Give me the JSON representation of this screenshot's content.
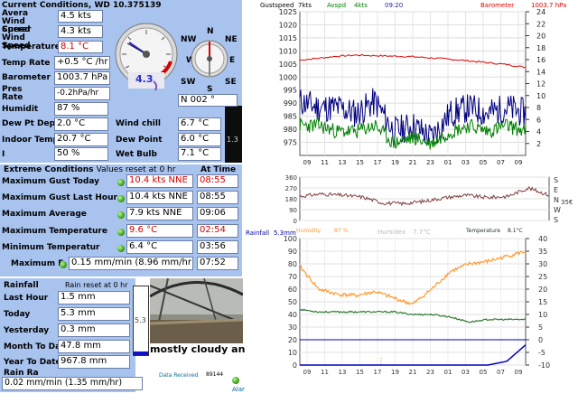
{
  "current": {
    "title": "Current Conditions, WD 10.375139",
    "avg_wind_label": "Avera Wind Speed",
    "avg_wind_value": "4.5 kts",
    "cur_wind_label": "Currer Wind Speed",
    "cur_wind_value": "4.3 kts",
    "temp_label": "Temperature",
    "temp_value": "8.1 °C",
    "temp_rate_label": "Temp Rate",
    "temp_rate_value": "+0.5 °C /hr",
    "baro_label": "Barometer",
    "baro_value": "1003.7 hPa",
    "pres_rate_label": "Pres Rate",
    "pres_rate_value": "-0.2hPa/hr",
    "humid_label": "Humidit",
    "humid_value": "87 %",
    "dewpt_label": "Dew Pt Depr",
    "dewpt_value": "2.0 °C",
    "indoor_label": "Indoor Temp",
    "indoor_value": "20.7 °C",
    "i_label": "I",
    "i_value": "50 %",
    "windchill_label": "Wind chill",
    "windchill_value": "6.7 °C",
    "dewpoint_label": "Dew Point",
    "dewpoint_value": "6.0 °C",
    "wetbulb_label": "Wet Bulb",
    "wetbulb_value": "7.1 °C",
    "side_value": "1.3",
    "gauge_value": "4.3",
    "compass": {
      "n": "N",
      "ne": "NE",
      "e": "E",
      "se": "SE",
      "s": "S",
      "sw": "SW",
      "w": "W",
      "nw": "NW"
    },
    "direction_value": "N  002 °"
  },
  "extreme": {
    "title": "Extreme Conditions",
    "reset_note": "Values reset at 0 hr",
    "at_time": "At Time",
    "rows": [
      {
        "label": "Maximum Gust Today",
        "value": "10.4 kts NNE",
        "time": "08:55"
      },
      {
        "label": "Maximum Gust Last Hour",
        "value": "10.4 kts NNE",
        "time": "08:55"
      },
      {
        "label": "Maximum Average",
        "value": "7.9 kts NNE",
        "time": "09:06"
      },
      {
        "label": "Maximum Temperature",
        "value": "9.6 °C",
        "time": "02:54"
      },
      {
        "label": "Minimum Temperatur",
        "value": "6.4 °C",
        "time": "03:56"
      },
      {
        "label": "Maximum F",
        "value": "0.15 mm/min (8.96 mm/hr)",
        "time": "07:52"
      }
    ]
  },
  "rain": {
    "title": "Rainfall",
    "reset_note": "Rain reset at 0 hr",
    "rows": [
      {
        "label": "Last Hour",
        "value": "1.5 mm"
      },
      {
        "label": "Today",
        "value": "5.3 mm"
      },
      {
        "label": "Yesterday",
        "value": "0.3 mm"
      },
      {
        "label": "Month To Dat",
        "value": "47.8 mm"
      },
      {
        "label": "Year To Date",
        "value": "967.8 mm"
      }
    ],
    "rate_label": "Rain Ra",
    "rate_value": "0.02 mm/min (1.35 mm/hr)",
    "bar_value": "5.3",
    "bar_fill": 0.05
  },
  "status": {
    "forecast": "mostly cloudy an",
    "time": "09:20:00",
    "data_received_label": "Data Received",
    "data_received_value": "89144",
    "alarm": "Alar"
  },
  "colors": {
    "panel": "#a9c3ef",
    "gust": "#000080",
    "avspd": "#008000",
    "barometer": "#e00000",
    "humidity": "#ff9a2e",
    "temperature": "#2f7a2f",
    "rain": "#0000c0",
    "direction": "#804040"
  },
  "chart_data": [
    {
      "type": "line",
      "legend": {
        "gust_label": "Gustspeed",
        "gust_value": "7kts",
        "avspd_label": "Avspd",
        "avspd_value": "4kts",
        "time": "09:20",
        "baro_label": "Barometer",
        "baro_value": "1003.7 hPa"
      },
      "x": [
        "09",
        "11",
        "13",
        "15",
        "17",
        "19",
        "21",
        "23",
        "01",
        "03",
        "05",
        "07",
        "09"
      ],
      "left_axis": {
        "ylim": [
          970,
          1025
        ],
        "ticks": [
          975,
          980,
          985,
          990,
          995,
          1000,
          1005,
          1010,
          1015,
          1020,
          1025
        ]
      },
      "right_axis": {
        "ylim": [
          0,
          24
        ],
        "ticks": [
          2,
          4,
          6,
          8,
          10,
          12,
          14,
          16,
          18,
          20,
          22,
          24
        ]
      },
      "series": [
        {
          "name": "Barometer",
          "values": [
            1006.5,
            1007.2,
            1008.0,
            1008.4,
            1008.2,
            1008.0,
            1007.8,
            1007.3,
            1006.8,
            1006.2,
            1005.5,
            1004.8,
            1003.7
          ]
        },
        {
          "name": "Gustspeed",
          "values": [
            9,
            8,
            8,
            7,
            9,
            4,
            5,
            3,
            7,
            8,
            7,
            8,
            7
          ]
        },
        {
          "name": "Avspd",
          "values": [
            5,
            5,
            4,
            4,
            5,
            2,
            3,
            2,
            4,
            5,
            4,
            5,
            4
          ]
        }
      ]
    },
    {
      "type": "line",
      "left_axis": {
        "ylim": [
          0,
          360
        ],
        "ticks": [
          0,
          90,
          180,
          270,
          360
        ]
      },
      "right_labels": [
        "S",
        "E",
        "N",
        "W",
        "S"
      ],
      "right_value": "35€",
      "series": [
        {
          "name": "Direction",
          "values": [
            200,
            220,
            210,
            195,
            145,
            140,
            160,
            190,
            210,
            190,
            200,
            270,
            210
          ]
        }
      ]
    },
    {
      "type": "line",
      "legend": {
        "rain_label": "Rainfall",
        "rain_value": "5.3mm",
        "humidity_label": "Humidity",
        "humidity_value": "87 %",
        "humidex_label": "Humidex",
        "humidex_value": "7.7°C",
        "temp_label": "Temperature",
        "temp_value": "8.1°C"
      },
      "x": [
        "09",
        "11",
        "13",
        "15",
        "17",
        "19",
        "21",
        "23",
        "01",
        "03",
        "05",
        "07",
        "09"
      ],
      "left_axis": {
        "ylim": [
          0,
          100
        ],
        "ticks": [
          0,
          10,
          20,
          30,
          40,
          50,
          60,
          70,
          80,
          90,
          100
        ]
      },
      "right_axis": {
        "ylim": [
          -10,
          40
        ],
        "ticks": [
          -10,
          -5,
          0,
          5,
          10,
          15,
          20,
          25,
          30,
          35,
          40
        ]
      },
      "series": [
        {
          "name": "Humidity",
          "values": [
            78,
            60,
            56,
            55,
            58,
            53,
            48,
            60,
            74,
            80,
            82,
            86,
            90
          ]
        },
        {
          "name": "Temperature",
          "values": [
            12,
            11,
            11,
            11,
            11,
            11,
            10,
            10,
            9,
            7,
            8,
            8,
            8
          ]
        },
        {
          "name": "Rainfall",
          "values": [
            0,
            0,
            0,
            0,
            0,
            0,
            0,
            0,
            0,
            0,
            0,
            1,
            5.3
          ]
        }
      ]
    }
  ]
}
